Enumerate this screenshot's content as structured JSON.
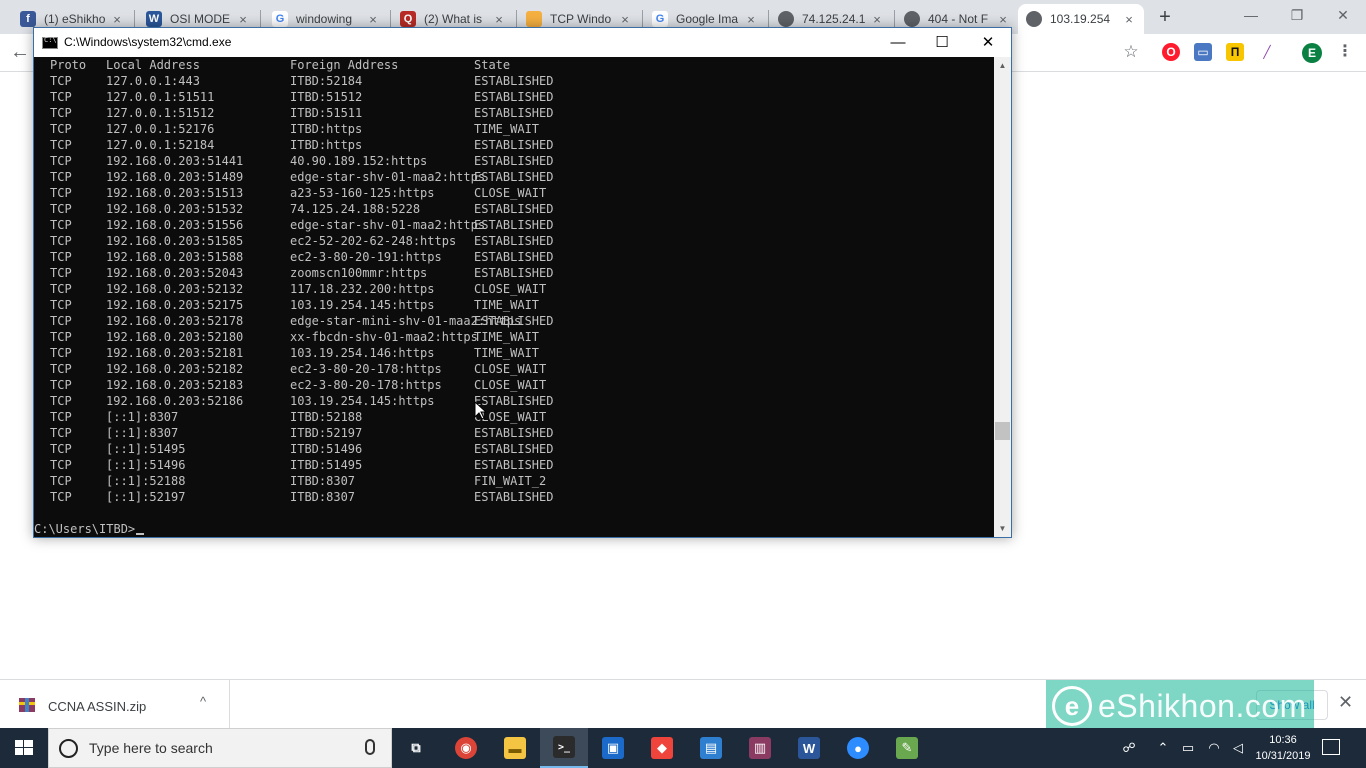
{
  "browser": {
    "tabs": [
      {
        "label": "(1) eShikho",
        "favicon": "facebook-icon",
        "favicon_text": "f",
        "color": "#3b5998"
      },
      {
        "label": "OSI MODE",
        "favicon": "word-icon",
        "favicon_text": "W",
        "color": "#2b579a"
      },
      {
        "label": "windowing",
        "favicon": "google-icon",
        "favicon_text": "G",
        "color": "#4285f4"
      },
      {
        "label": "(2) What is",
        "favicon": "quora-icon",
        "favicon_text": "Q",
        "color": "#b92b27"
      },
      {
        "label": "TCP Windo",
        "favicon": "hand-icon",
        "favicon_text": "",
        "color": "#f5b041"
      },
      {
        "label": "Google Ima",
        "favicon": "google-icon",
        "favicon_text": "G",
        "color": "#4285f4"
      },
      {
        "label": "74.125.24.1",
        "favicon": "globe-icon",
        "favicon_text": "",
        "color": "#5f6368"
      },
      {
        "label": "404 - Not F",
        "favicon": "globe-icon",
        "favicon_text": "",
        "color": "#5f6368"
      },
      {
        "label": "103.19.254",
        "favicon": "globe-icon",
        "favicon_text": "",
        "color": "#5f6368"
      }
    ],
    "tab_close_glyph": "×",
    "new_tab_glyph": "+",
    "toolbar": {
      "back_glyph": "←",
      "star_glyph": "☆",
      "profile_letter": "E",
      "menu_glyph": "⋮"
    }
  },
  "cmd": {
    "title": "C:\\Windows\\system32\\cmd.exe",
    "header": {
      "proto": "Proto",
      "local": "Local Address",
      "foreign": "Foreign Address",
      "state": "State"
    },
    "rows": [
      {
        "proto": "TCP",
        "local": "127.0.0.1:443",
        "foreign": "ITBD:52184",
        "state": "ESTABLISHED"
      },
      {
        "proto": "TCP",
        "local": "127.0.0.1:51511",
        "foreign": "ITBD:51512",
        "state": "ESTABLISHED"
      },
      {
        "proto": "TCP",
        "local": "127.0.0.1:51512",
        "foreign": "ITBD:51511",
        "state": "ESTABLISHED"
      },
      {
        "proto": "TCP",
        "local": "127.0.0.1:52176",
        "foreign": "ITBD:https",
        "state": "TIME_WAIT"
      },
      {
        "proto": "TCP",
        "local": "127.0.0.1:52184",
        "foreign": "ITBD:https",
        "state": "ESTABLISHED"
      },
      {
        "proto": "TCP",
        "local": "192.168.0.203:51441",
        "foreign": "40.90.189.152:https",
        "state": "ESTABLISHED"
      },
      {
        "proto": "TCP",
        "local": "192.168.0.203:51489",
        "foreign": "edge-star-shv-01-maa2:https",
        "state": "ESTABLISHED"
      },
      {
        "proto": "TCP",
        "local": "192.168.0.203:51513",
        "foreign": "a23-53-160-125:https",
        "state": "CLOSE_WAIT"
      },
      {
        "proto": "TCP",
        "local": "192.168.0.203:51532",
        "foreign": "74.125.24.188:5228",
        "state": "ESTABLISHED"
      },
      {
        "proto": "TCP",
        "local": "192.168.0.203:51556",
        "foreign": "edge-star-shv-01-maa2:https",
        "state": "ESTABLISHED"
      },
      {
        "proto": "TCP",
        "local": "192.168.0.203:51585",
        "foreign": "ec2-52-202-62-248:https",
        "state": "ESTABLISHED"
      },
      {
        "proto": "TCP",
        "local": "192.168.0.203:51588",
        "foreign": "ec2-3-80-20-191:https",
        "state": "ESTABLISHED"
      },
      {
        "proto": "TCP",
        "local": "192.168.0.203:52043",
        "foreign": "zoomscn100mmr:https",
        "state": "ESTABLISHED"
      },
      {
        "proto": "TCP",
        "local": "192.168.0.203:52132",
        "foreign": "117.18.232.200:https",
        "state": "CLOSE_WAIT"
      },
      {
        "proto": "TCP",
        "local": "192.168.0.203:52175",
        "foreign": "103.19.254.145:https",
        "state": "TIME_WAIT"
      },
      {
        "proto": "TCP",
        "local": "192.168.0.203:52178",
        "foreign": "edge-star-mini-shv-01-maa2:https",
        "state": "ESTABLISHED"
      },
      {
        "proto": "TCP",
        "local": "192.168.0.203:52180",
        "foreign": "xx-fbcdn-shv-01-maa2:https",
        "state": "TIME_WAIT"
      },
      {
        "proto": "TCP",
        "local": "192.168.0.203:52181",
        "foreign": "103.19.254.146:https",
        "state": "TIME_WAIT"
      },
      {
        "proto": "TCP",
        "local": "192.168.0.203:52182",
        "foreign": "ec2-3-80-20-178:https",
        "state": "CLOSE_WAIT"
      },
      {
        "proto": "TCP",
        "local": "192.168.0.203:52183",
        "foreign": "ec2-3-80-20-178:https",
        "state": "CLOSE_WAIT"
      },
      {
        "proto": "TCP",
        "local": "192.168.0.203:52186",
        "foreign": "103.19.254.145:https",
        "state": "ESTABLISHED"
      },
      {
        "proto": "TCP",
        "local": "[::1]:8307",
        "foreign": "ITBD:52188",
        "state": "CLOSE_WAIT"
      },
      {
        "proto": "TCP",
        "local": "[::1]:8307",
        "foreign": "ITBD:52197",
        "state": "ESTABLISHED"
      },
      {
        "proto": "TCP",
        "local": "[::1]:51495",
        "foreign": "ITBD:51496",
        "state": "ESTABLISHED"
      },
      {
        "proto": "TCP",
        "local": "[::1]:51496",
        "foreign": "ITBD:51495",
        "state": "ESTABLISHED"
      },
      {
        "proto": "TCP",
        "local": "[::1]:52188",
        "foreign": "ITBD:8307",
        "state": "FIN_WAIT_2"
      },
      {
        "proto": "TCP",
        "local": "[::1]:52197",
        "foreign": "ITBD:8307",
        "state": "ESTABLISHED"
      }
    ],
    "prompt": "C:\\Users\\ITBD>",
    "buttons": {
      "minimize": "—",
      "maximize": "☐",
      "close": "✕"
    }
  },
  "downloads": {
    "file_name": "CCNA ASSIN.zip",
    "chevron": "^",
    "show_all": "Show all",
    "close": "✕"
  },
  "watermark": {
    "text": "eShikhon.com",
    "logo_letter": "e"
  },
  "taskbar": {
    "search_placeholder": "Type here to search",
    "clock_time": "10:36",
    "clock_date": "10/31/2019",
    "apps": [
      {
        "name": "task-view",
        "glyph": "⧉",
        "color": "#1c2a3a"
      },
      {
        "name": "chrome",
        "glyph": "◉",
        "color": "#db4437"
      },
      {
        "name": "file-explorer",
        "glyph": "▬",
        "color": "#f4c542"
      },
      {
        "name": "cmd",
        "glyph": ">_",
        "color": "#2b2b2b"
      },
      {
        "name": "virtualbox",
        "glyph": "▣",
        "color": "#1b6ac9"
      },
      {
        "name": "anydesk",
        "glyph": "◆",
        "color": "#ef443b"
      },
      {
        "name": "network-app",
        "glyph": "▤",
        "color": "#2f7fd0"
      },
      {
        "name": "winrar",
        "glyph": "▥",
        "color": "#8b3a62"
      },
      {
        "name": "word",
        "glyph": "W",
        "color": "#2b579a"
      },
      {
        "name": "zoom",
        "glyph": "●",
        "color": "#2d8cff"
      },
      {
        "name": "paint",
        "glyph": "✎",
        "color": "#6aa84f"
      }
    ]
  }
}
